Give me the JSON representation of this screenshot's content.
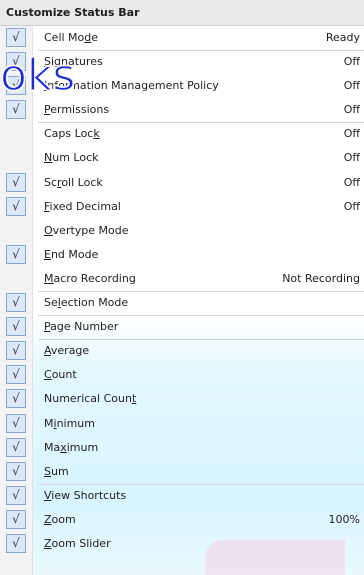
{
  "menu": {
    "title": "Customize Status Bar",
    "check_glyph": "√",
    "items": [
      {
        "pre": "Cell Mo",
        "acc": "d",
        "post": "e",
        "value": "Ready",
        "checked": true,
        "sep_top": false
      },
      {
        "pre": "",
        "acc": "S",
        "post": "ignatures",
        "value": "Off",
        "checked": true,
        "sep_top": true
      },
      {
        "pre": "",
        "acc": "I",
        "post": "nformation Management Policy",
        "value": "Off",
        "checked": true,
        "sep_top": false
      },
      {
        "pre": "",
        "acc": "P",
        "post": "ermissions",
        "value": "Off",
        "checked": true,
        "sep_top": false
      },
      {
        "pre": "Caps Loc",
        "acc": "k",
        "post": "",
        "value": "Off",
        "checked": false,
        "sep_top": true
      },
      {
        "pre": "",
        "acc": "N",
        "post": "um Lock",
        "value": "Off",
        "checked": false,
        "sep_top": false
      },
      {
        "pre": "Sc",
        "acc": "r",
        "post": "oll Lock",
        "value": "Off",
        "checked": true,
        "sep_top": false
      },
      {
        "pre": "",
        "acc": "F",
        "post": "ixed Decimal",
        "value": "Off",
        "checked": true,
        "sep_top": false
      },
      {
        "pre": "",
        "acc": "O",
        "post": "vertype Mode",
        "value": "",
        "checked": false,
        "sep_top": false
      },
      {
        "pre": "",
        "acc": "E",
        "post": "nd Mode",
        "value": "",
        "checked": true,
        "sep_top": false
      },
      {
        "pre": "",
        "acc": "M",
        "post": "acro Recording",
        "value": "Not Recording",
        "checked": false,
        "sep_top": false
      },
      {
        "pre": "Se",
        "acc": "l",
        "post": "ection Mode",
        "value": "",
        "checked": true,
        "sep_top": true
      },
      {
        "pre": "",
        "acc": "P",
        "post": "age Number",
        "value": "",
        "checked": true,
        "sep_top": true
      },
      {
        "pre": "",
        "acc": "A",
        "post": "verage",
        "value": "",
        "checked": true,
        "sep_top": true
      },
      {
        "pre": "",
        "acc": "C",
        "post": "ount",
        "value": "",
        "checked": true,
        "sep_top": false
      },
      {
        "pre": "Numerical Coun",
        "acc": "t",
        "post": "",
        "value": "",
        "checked": true,
        "sep_top": false
      },
      {
        "pre": "M",
        "acc": "i",
        "post": "nimum",
        "value": "",
        "checked": true,
        "sep_top": false
      },
      {
        "pre": "Ma",
        "acc": "x",
        "post": "imum",
        "value": "",
        "checked": true,
        "sep_top": false
      },
      {
        "pre": "",
        "acc": "S",
        "post": "um",
        "value": "",
        "checked": true,
        "sep_top": false
      },
      {
        "pre": "",
        "acc": "V",
        "post": "iew Shortcuts",
        "value": "",
        "checked": true,
        "sep_top": true
      },
      {
        "pre": "",
        "acc": "Z",
        "post": "oom",
        "value": "100%",
        "checked": true,
        "sep_top": false
      },
      {
        "pre": "",
        "acc": "Z",
        "post": "oom Slider",
        "value": "",
        "checked": true,
        "sep_top": false
      }
    ]
  },
  "watermark": {
    "text": "oks",
    "color": "#1e2bd6"
  }
}
